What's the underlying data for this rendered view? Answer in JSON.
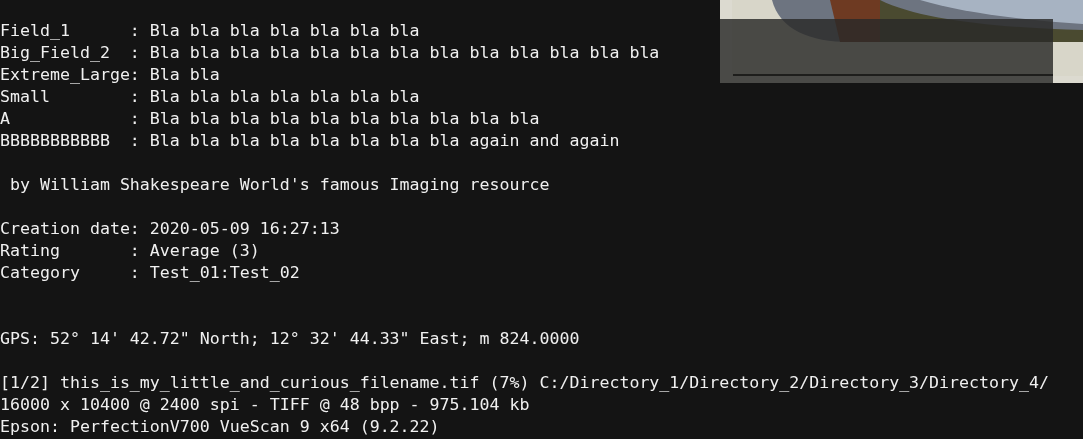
{
  "blocks": [
    {
      "lines": [
        "Field_1      : Bla bla bla bla bla bla bla",
        "Big_Field_2  : Bla bla bla bla bla bla bla bla bla bla bla bla bla",
        "Extreme_Large: Bla bla",
        "Small        : Bla bla bla bla bla bla bla",
        "A            : Bla bla bla bla bla bla bla bla bla bla",
        "BBBBBBBBBBB  : Bla bla bla bla bla bla bla bla again and again"
      ]
    },
    {
      "lines": [
        " by William Shakespeare World's famous Imaging resource"
      ]
    },
    {
      "lines": [
        "Creation date: 2020-05-09 16:27:13",
        "Rating       : Average (3)",
        "Category     : Test_01:Test_02"
      ]
    },
    {
      "lines": [
        "GPS: 52° 14' 42.72\" North; 12° 32' 44.33\" East; m 824.0000"
      ]
    },
    {
      "lines": [
        "[1/2] this_is_my_little_and_curious_filename.tif (7%) C:/Directory_1/Directory_2/Directory_3/Directory_4/",
        "16000 x 10400 @ 2400 spi - TIFF @ 48 bpp - 975.104 kb",
        "Epson: PerfectionV700 VueScan 9 x64 (9.2.22)"
      ]
    }
  ]
}
